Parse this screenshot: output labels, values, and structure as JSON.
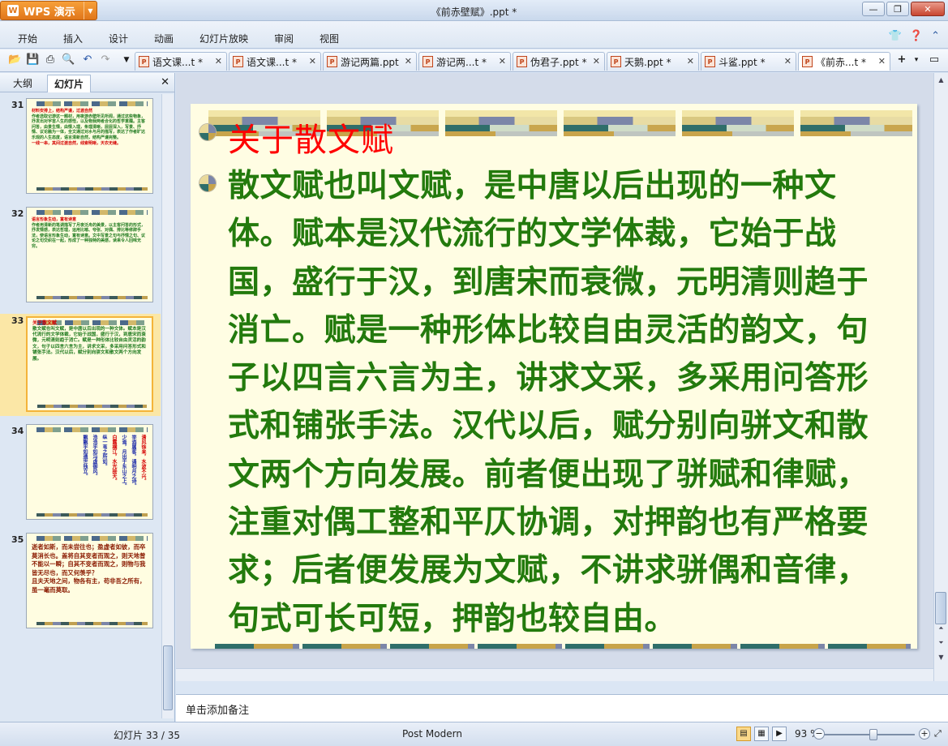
{
  "app": {
    "button_label": "WPS 演示",
    "window_title": "《前赤壁赋》.ppt *"
  },
  "menu": [
    "开始",
    "插入",
    "设计",
    "动画",
    "幻灯片放映",
    "审阅",
    "视图"
  ],
  "doc_tabs": [
    {
      "label": "语文课...t *"
    },
    {
      "label": "语文课...t *"
    },
    {
      "label": "游记两篇.ppt"
    },
    {
      "label": "游记两...t *"
    },
    {
      "label": "伪君子.ppt *"
    },
    {
      "label": "天鹅.ppt *"
    },
    {
      "label": "斗鲨.ppt *"
    },
    {
      "label": "《前赤...t *"
    }
  ],
  "left_panel": {
    "tab_outline": "大纲",
    "tab_slides": "幻灯片"
  },
  "thumbnails": [
    {
      "num": "31",
      "heading": "材料安排上，结构严谨，过渡自然",
      "text": "作者选取记游这一题材，用夜游赤壁所见所闻，通过这些物象，抒发出对宇宙人生的感悟，以及物我两者合化的哲学意蕴。主客问答，由景生情，由情入理，条理清晰，层层深入，写景、抒情、议论融为一体，全文通过对水与月的描写，表达了作者旷达乐观的人生态度，语言清新自然，结构严谨完整。",
      "tail": "一线一串，其间过渡自然，线索明晰，天衣无缝。"
    },
    {
      "num": "32",
      "heading": "语言形象生动，富有诗意",
      "text": "作者用清新的笔调描写了月夜泛舟的美景，以主客问答的形式，抒发情感，表达哲理，运用比喻、夸张、对偶、排比等修辞手法，使语言形象生动，富有诗意。文中写景之句与抒情之句、议论之句交织在一起，形成了一种独特的美感，读来令人回味无穷。"
    },
    {
      "num": "33",
      "heading": "关于散文赋",
      "text": "散文赋也叫文赋，是中唐以后出现的一种文体。赋本是汉代流行的文学体裁，它始于战国，盛行于汉，到唐宋而衰微，元明清则趋于消亡。赋是一种形体比较自由灵活的韵文，句子以四言六言为主，讲求文采，多采用问答形式和铺张手法。汉代以后，赋分别向骈文和散文两个方向发展。"
    },
    {
      "num": "34",
      "cols": [
        "清风徐来，水波不兴。",
        "举酒属客，诵明月之诗。",
        "少焉，月出于东山之上。",
        "白露横江，水光接天。",
        "纵一苇之所如。",
        "浩浩乎如冯虚御风。",
        "飘飘乎如遗世独立。"
      ]
    },
    {
      "num": "35",
      "text1": "逝者如斯，而未尝往也；盈虚者如彼，而卒莫消长也。盖将自其变者而观之，则天地曾不能以一瞬；自其不变者而观之，则物与我皆无尽也，而又何羡乎？",
      "text2": "且夫天地之间，物各有主，苟非吾之所有，虽一毫而莫取。"
    }
  ],
  "slide": {
    "title": "关于散文赋",
    "body": "散文赋也叫文赋，是中唐以后出现的一种文体。赋本是汉代流行的文学体裁，它始于战国，盛行于汉，到唐宋而衰微，元明清则趋于消亡。赋是一种形体比较自由灵活的韵文，句子以四言六言为主，讲求文采，多采用问答形式和铺张手法。汉代以后，赋分别向骈文和散文两个方向发展。前者便出现了骈赋和律赋，注重对偶工整和平仄协调，对押韵也有严格要求；后者便发展为文赋，不讲求骈偶和音律，句式可长可短，押韵也较自由。"
  },
  "notes_placeholder": "单击添加备注",
  "status": {
    "slide_counter": "幻灯片 33 / 35",
    "theme": "Post Modern",
    "zoom": "93 %"
  },
  "colors": {
    "title_red": "#ff0000",
    "body_green": "#237a0d",
    "slide_bg": "#fffde3",
    "app_orange": "#e0761a"
  }
}
